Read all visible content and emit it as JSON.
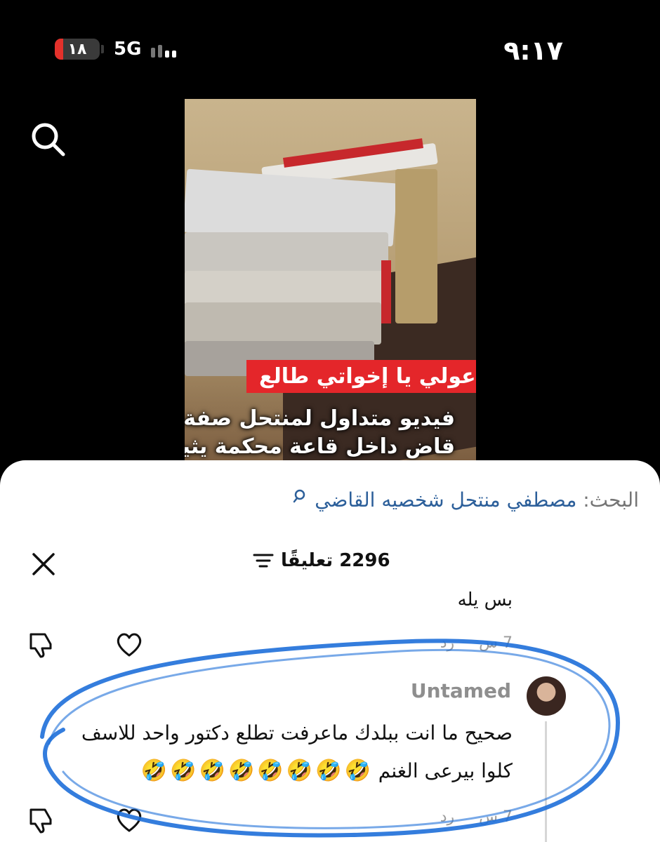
{
  "status_bar": {
    "time": "٩:١٧",
    "battery_level": "١٨",
    "battery_fraction": 0.18,
    "network": "5G",
    "signal_bars": 2,
    "accent_color": "#e4312b"
  },
  "video": {
    "caption_red": "ادعولي يا إخواتي طالع",
    "caption_line1": "فيديو متداول لمنتحل صفة",
    "caption_line2": "قاض داخل قاعة محكمة يثير"
  },
  "comments_panel": {
    "search_prefix": "البحث:",
    "search_query": "مصطفي منتحل شخصيه القاضي",
    "comments_count": "2296 تعليقًا",
    "previous_comment": {
      "text": "بس يله",
      "time": "7 س",
      "reply_label": "رد"
    },
    "comment": {
      "username": "Untamed",
      "line1": "صحيح ما انت ببلدك ماعرفت تطلع دكتور واحد للاسف",
      "line2": "كلوا بيرعى الغنم",
      "emoji": "🤣",
      "emoji_count": 8,
      "time": "7 س",
      "reply_label": "رد"
    },
    "link_color": "#2c5f9a",
    "highlight_color": "#1e6fd9"
  }
}
